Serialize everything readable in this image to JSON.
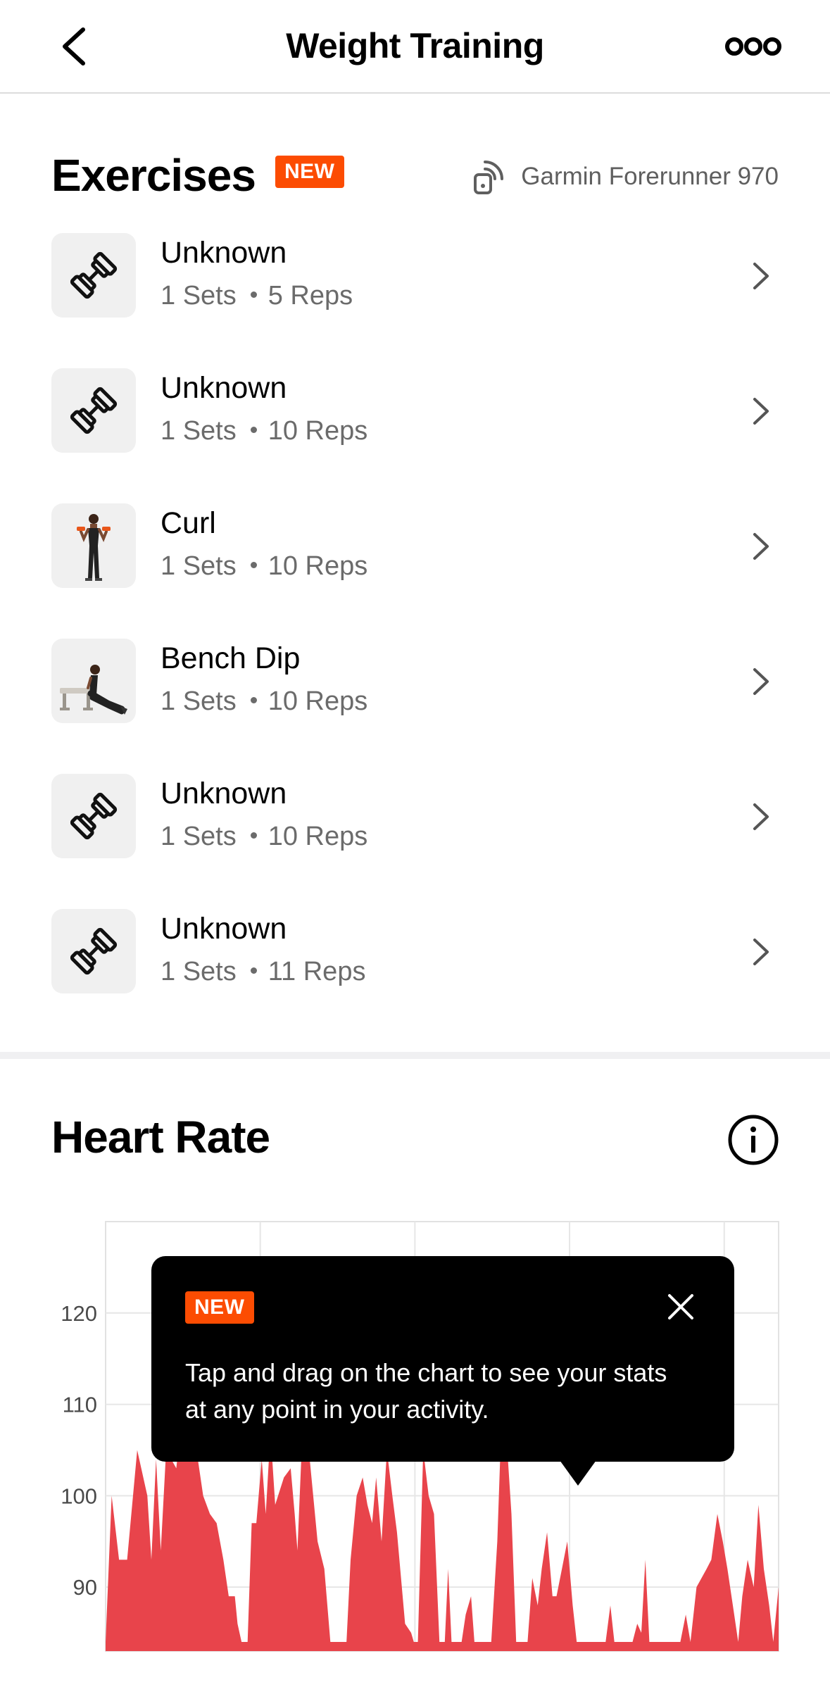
{
  "header": {
    "title": "Weight Training"
  },
  "exercises": {
    "title": "Exercises",
    "badge": "NEW",
    "device": "Garmin Forerunner 970",
    "items": [
      {
        "name": "Unknown",
        "sets": "1 Sets",
        "reps": "5 Reps",
        "thumb": "dumbbell-icon"
      },
      {
        "name": "Unknown",
        "sets": "1 Sets",
        "reps": "10 Reps",
        "thumb": "dumbbell-icon"
      },
      {
        "name": "Curl",
        "sets": "1 Sets",
        "reps": "10 Reps",
        "thumb": "curl-figure"
      },
      {
        "name": "Bench Dip",
        "sets": "1 Sets",
        "reps": "10 Reps",
        "thumb": "bench-dip-figure"
      },
      {
        "name": "Unknown",
        "sets": "1 Sets",
        "reps": "10 Reps",
        "thumb": "dumbbell-icon"
      },
      {
        "name": "Unknown",
        "sets": "1 Sets",
        "reps": "11 Reps",
        "thumb": "dumbbell-icon"
      }
    ]
  },
  "heart_rate": {
    "title": "Heart Rate"
  },
  "tooltip": {
    "badge": "NEW",
    "text": "Tap and drag on the chart to see your stats at any point in your activity."
  },
  "colors": {
    "accent": "#fc4c02",
    "chart_fill": "#e8444b"
  },
  "chart_data": {
    "type": "area",
    "title": "",
    "xlabel": "",
    "ylabel": "",
    "yticks": [
      90,
      100,
      110,
      120
    ],
    "ylim": [
      83,
      130
    ],
    "xlim": [
      0,
      100
    ],
    "grid": true,
    "series": [
      {
        "values": [
          [
            0,
            84
          ],
          [
            0.9,
            100
          ],
          [
            2,
            93
          ],
          [
            3.2,
            93
          ],
          [
            4.7,
            105
          ],
          [
            6.2,
            100
          ],
          [
            6.8,
            93
          ],
          [
            7.5,
            104
          ],
          [
            8.2,
            94
          ],
          [
            9,
            105
          ],
          [
            10.5,
            103
          ],
          [
            11.5,
            110
          ],
          [
            12.5,
            112
          ],
          [
            13.5,
            105
          ],
          [
            14.5,
            100
          ],
          [
            15.5,
            98
          ],
          [
            16.5,
            97
          ],
          [
            17.5,
            93
          ],
          [
            18.3,
            89
          ],
          [
            19.2,
            89
          ],
          [
            19.6,
            86
          ],
          [
            20.2,
            84
          ],
          [
            21.1,
            84
          ],
          [
            21.7,
            97
          ],
          [
            22.4,
            97
          ],
          [
            23.2,
            104
          ],
          [
            23.8,
            98
          ],
          [
            24.5,
            107
          ],
          [
            25.2,
            99
          ],
          [
            26.5,
            102
          ],
          [
            27.5,
            103
          ],
          [
            28.1,
            98
          ],
          [
            28.5,
            94
          ],
          [
            29.3,
            108
          ],
          [
            30.2,
            105
          ],
          [
            31.5,
            95
          ],
          [
            32.5,
            92
          ],
          [
            33.4,
            84
          ],
          [
            35.8,
            84
          ],
          [
            36.4,
            93
          ],
          [
            37.3,
            100
          ],
          [
            38.2,
            102
          ],
          [
            38.9,
            99
          ],
          [
            39.6,
            97
          ],
          [
            40.2,
            102
          ],
          [
            41,
            95
          ],
          [
            41.8,
            105
          ],
          [
            42.6,
            100
          ],
          [
            43.3,
            96
          ],
          [
            44.5,
            86
          ],
          [
            45.4,
            85
          ],
          [
            45.8,
            84
          ],
          [
            46.4,
            84
          ],
          [
            47.2,
            105
          ],
          [
            48,
            100
          ],
          [
            48.8,
            98
          ],
          [
            49.6,
            84
          ],
          [
            50.4,
            84
          ],
          [
            50.9,
            92
          ],
          [
            51.4,
            84
          ],
          [
            52.9,
            84
          ],
          [
            53.5,
            87
          ],
          [
            54.3,
            89
          ],
          [
            54.8,
            84
          ],
          [
            57.3,
            84
          ],
          [
            58.2,
            95
          ],
          [
            58.9,
            110
          ],
          [
            59.6,
            106
          ],
          [
            60.3,
            98
          ],
          [
            61,
            84
          ],
          [
            62.7,
            84
          ],
          [
            63.4,
            91
          ],
          [
            64.2,
            88
          ],
          [
            64.8,
            92
          ],
          [
            65.6,
            96
          ],
          [
            66.4,
            89
          ],
          [
            67,
            89
          ],
          [
            67.8,
            92
          ],
          [
            68.6,
            95
          ],
          [
            69.4,
            88
          ],
          [
            70,
            84
          ],
          [
            74.3,
            84
          ],
          [
            75,
            88
          ],
          [
            75.6,
            84
          ],
          [
            78.3,
            84
          ],
          [
            79,
            86
          ],
          [
            79.6,
            85
          ],
          [
            80.2,
            93
          ],
          [
            80.8,
            84
          ],
          [
            85.4,
            84
          ],
          [
            86.2,
            87
          ],
          [
            86.9,
            84
          ],
          [
            87.8,
            90
          ],
          [
            89.3,
            92
          ],
          [
            90,
            93
          ],
          [
            90.9,
            98
          ],
          [
            91.7,
            95
          ],
          [
            92.4,
            92
          ],
          [
            93.2,
            88
          ],
          [
            94,
            84
          ],
          [
            94.6,
            89
          ],
          [
            95.4,
            93
          ],
          [
            96.3,
            90
          ],
          [
            97,
            99
          ],
          [
            97.8,
            92
          ],
          [
            98.6,
            88
          ],
          [
            99.2,
            84
          ],
          [
            100,
            90
          ]
        ]
      }
    ]
  }
}
